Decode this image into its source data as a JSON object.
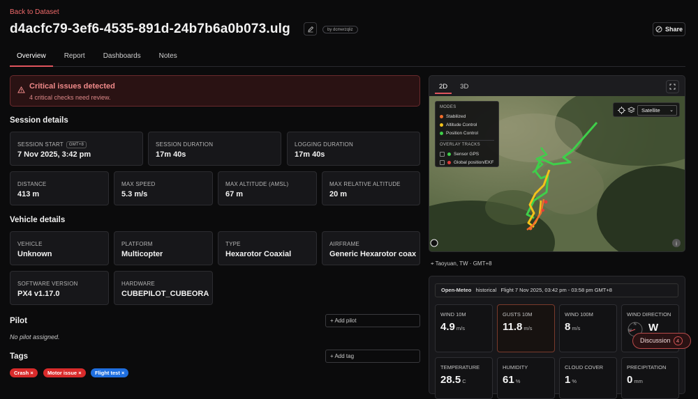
{
  "header": {
    "back_link": "Back to Dataset",
    "title": "d4acfc79-3ef6-4535-891d-24b7b6a0b073.ulg",
    "user_pill": "by dcmerzqliz",
    "share_label": "Share"
  },
  "tabs": [
    "Overview",
    "Report",
    "Dashboards",
    "Notes"
  ],
  "active_tab": "Overview",
  "alert": {
    "title": "Critical issues detected",
    "message": "4 critical checks need review."
  },
  "session": {
    "heading": "Session details",
    "start_label": "SESSION START",
    "tz_badge": "GMT+8",
    "start_value": "7 Nov 2025, 3:42 pm",
    "duration_label": "SESSION DURATION",
    "duration_value": "17m 40s",
    "logging_label": "LOGGING DURATION",
    "logging_value": "17m 40s",
    "distance_label": "DISTANCE",
    "distance_value": "413 m",
    "speed_label": "MAX SPEED",
    "speed_value": "5.3 m/s",
    "alt_label": "MAX ALTITUDE (AMSL)",
    "alt_value": "67 m",
    "relalt_label": "MAX RELATIVE ALTITUDE",
    "relalt_value": "20 m"
  },
  "vehicle": {
    "heading": "Vehicle details",
    "vehicle_label": "VEHICLE",
    "vehicle_value": "Unknown",
    "platform_label": "PLATFORM",
    "platform_value": "Multicopter",
    "type_label": "TYPE",
    "type_value": "Hexarotor Coaxial",
    "airframe_label": "AIRFRAME",
    "airframe_value": "Generic Hexarotor coax…",
    "software_label": "SOFTWARE VERSION",
    "software_value": "PX4 v1.17.0",
    "hardware_label": "HARDWARE",
    "hardware_value": "CUBEPILOT_CUBEORA…"
  },
  "pilot": {
    "heading": "Pilot",
    "add_label": "+ Add pilot",
    "empty_text": "No pilot assigned."
  },
  "tags": {
    "heading": "Tags",
    "add_label": "+ Add tag",
    "items": [
      {
        "label": "Crash",
        "color": "#d92b2b"
      },
      {
        "label": "Motor issue",
        "color": "#d92b2b"
      },
      {
        "label": "Flight test",
        "color": "#1f6fe0"
      }
    ]
  },
  "map": {
    "tab_2d": "2D",
    "tab_3d": "3D",
    "legend_modes_heading": "MODES",
    "modes": [
      {
        "label": "Stabilized",
        "color": "#f26d2a"
      },
      {
        "label": "Altitude Control",
        "color": "#f3c21a"
      },
      {
        "label": "Position Control",
        "color": "#3fcf4a"
      }
    ],
    "overlay_heading": "OVERLAY TRACKS",
    "overlays": [
      {
        "label": "Sensor GPS",
        "color": "#3fcf4a"
      },
      {
        "label": "Global position/EKF",
        "color": "#e23b3b"
      }
    ],
    "basemap": "Satellite",
    "location": "Taoyuan, TW · GMT+8"
  },
  "weather": {
    "source": "Open-Meteo",
    "mode": "historical",
    "range": "Flight 7 Nov 2025, 03:42 pm - 03:58 pm GMT+8",
    "wind10_label": "WIND 10M",
    "wind10_value": "4.9",
    "wind10_unit": "m/s",
    "gusts_label": "GUSTS 10M",
    "gusts_value": "11.8",
    "gusts_unit": "m/s",
    "wind100_label": "WIND 100M",
    "wind100_value": "8",
    "wind100_unit": "m/s",
    "dir_label": "WIND DIRECTION",
    "dir_value": "W",
    "compass_n": "N",
    "compass_w": "W",
    "temp_label": "TEMPERATURE",
    "temp_value": "28.5",
    "temp_unit": "C",
    "hum_label": "HUMIDITY",
    "hum_value": "61",
    "hum_unit": "%",
    "cloud_label": "CLOUD COVER",
    "cloud_value": "1",
    "cloud_unit": "%",
    "precip_label": "PRECIPITATION",
    "precip_value": "0",
    "precip_unit": "mm"
  },
  "discussion": {
    "label": "Discussion",
    "count": "4"
  }
}
